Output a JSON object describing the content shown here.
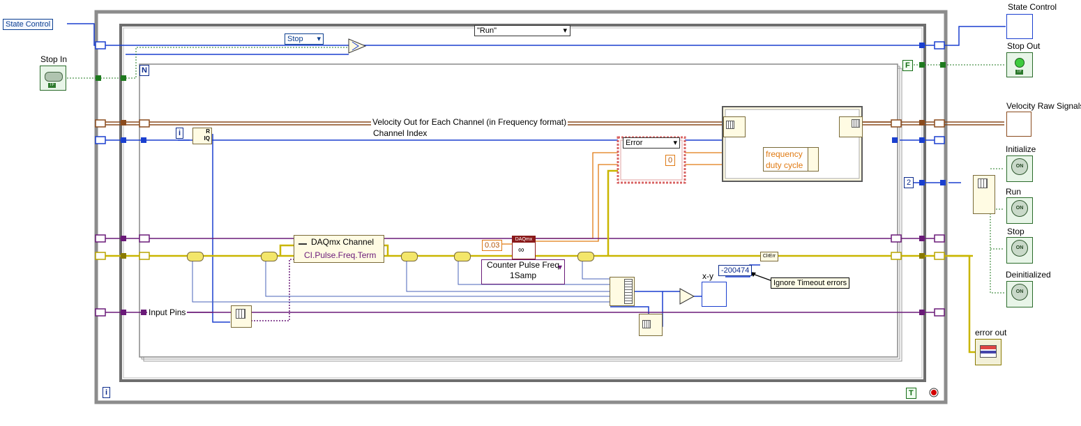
{
  "terminals": {
    "state_control_in": "State Control",
    "stop_in": "Stop In",
    "state_control_out": "State Control",
    "stop_out": "Stop Out",
    "velocity_raw_signals": "Velocity Raw Signals",
    "initialize": "Initialize",
    "run": "Run",
    "stop": "Stop",
    "deinitialized": "Deinitialized",
    "error_out": "error out",
    "xy": "x-y"
  },
  "case_structure": {
    "selector": "\"Run\"",
    "stop_enum": "Stop",
    "error_case": "Error"
  },
  "labels": {
    "velocity_wire": "Velocity Out for Each Channel (in Frequency format)",
    "channel_index": "Channel Index",
    "input_pins": "Input Pins",
    "ignore_timeout": "Ignore Timeout errors",
    "frequency": "frequency",
    "duty_cycle": "duty cycle",
    "loop_count": "N",
    "index_i": "i",
    "clr_err": "ClrErr"
  },
  "nodes": {
    "daqmx_channel": "DAQmx Channel",
    "ci_term": "CI.Pulse.Freq.Term",
    "counter_mode_line1": "Counter Pulse Freq",
    "counter_mode_line2": "1Samp",
    "daqmx_badge": "DAQmx",
    "timeout_value": "0.03"
  },
  "constants": {
    "error_code": "-200474",
    "array_size": "2",
    "zero": "0",
    "false_const": "F",
    "true_const": "T",
    "iteration": "i"
  },
  "led_labels": {
    "on": "ON",
    "tf": "TF"
  },
  "colors": {
    "frame_gray": "#909090",
    "wire_blue": "#1a3fcf",
    "wire_orange": "#e07a12",
    "wire_brown": "#8a4a1c",
    "wire_purple": "#6a1a78",
    "wire_yellow": "#d4c200",
    "wire_green": "#1f7a1f",
    "case_red": "#d86464"
  }
}
